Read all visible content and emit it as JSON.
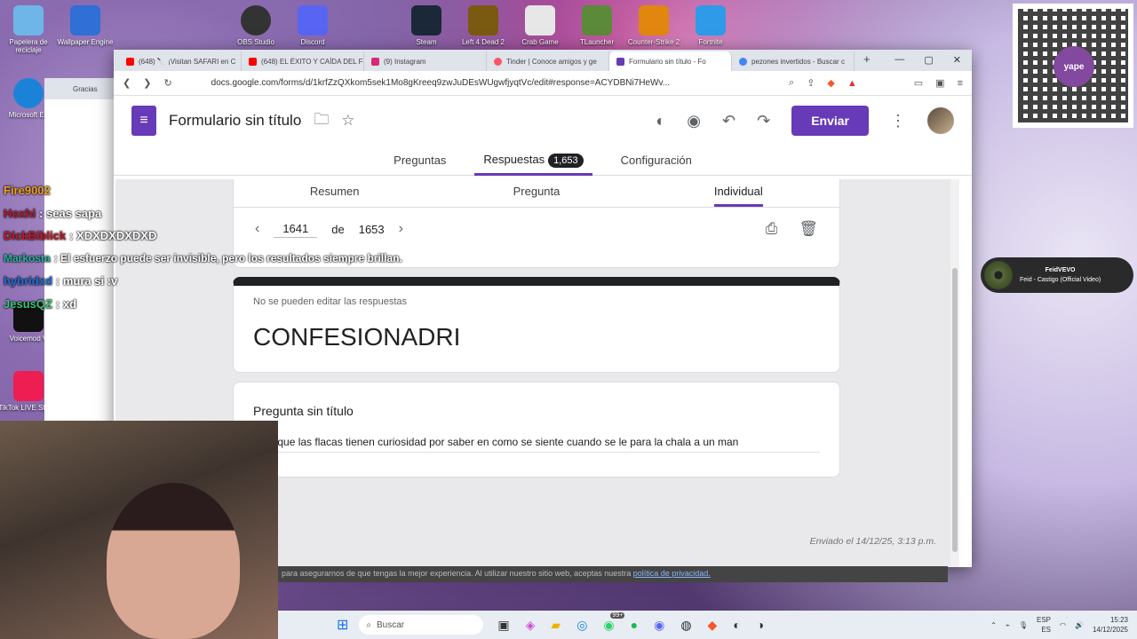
{
  "desktop_icons": [
    {
      "label": "Papelera de reciclaje",
      "color": "#6fb6e8"
    },
    {
      "label": "Wallpaper Engine",
      "color": "#2f6fd6"
    },
    {
      "label": "OBS Studio",
      "color": "#333333"
    },
    {
      "label": "Discord",
      "color": "#5865f2"
    },
    {
      "label": "Steam",
      "color": "#1b2838"
    },
    {
      "label": "Left 4 Dead 2",
      "color": "#7a5a10"
    },
    {
      "label": "Crab Game",
      "color": "#e7e7e7"
    },
    {
      "label": "TLauncher",
      "color": "#5b8a3a"
    },
    {
      "label": "Counter-Strike 2",
      "color": "#e1860f"
    },
    {
      "label": "Fortnite",
      "color": "#2f9ae8"
    },
    {
      "label": "Microsoft Ed",
      "color": "#1a83d8"
    },
    {
      "label": "Voicemod V",
      "color": "#111111"
    },
    {
      "label": "TikTok LIVE Studio",
      "color": "#ee1d52"
    }
  ],
  "browser": {
    "tabs": [
      {
        "label": "(648) 🔪 ¡Visitan SAFARI en C",
        "icon": "youtube-icon",
        "color": "#ff0000",
        "active": false
      },
      {
        "label": "(648) EL ÉXITO Y CAÍDA DEL F",
        "icon": "youtube-icon",
        "color": "#ff0000",
        "active": false
      },
      {
        "label": "(9) Instagram",
        "icon": "instagram-icon",
        "color": "#d62976",
        "active": false
      },
      {
        "label": "Tinder | Conoce amigos y ge",
        "icon": "tinder-icon",
        "color": "#fd5564",
        "active": false
      },
      {
        "label": "Formulario sin título - Fo",
        "icon": "forms-icon",
        "color": "#673ab7",
        "active": true
      },
      {
        "label": "pezones invertidos - Buscar c",
        "icon": "google-icon",
        "color": "#4285f4",
        "active": false
      }
    ],
    "url": "docs.google.com/forms/d/1krfZzQXkom5sek1Mo8gKreeq9zwJuDEsWUgwfjyqtVc/edit#response=ACYDBNi7HeWv..."
  },
  "forms": {
    "title": "Formulario sin título",
    "send_label": "Enviar",
    "tabs": {
      "questions": "Preguntas",
      "responses": "Respuestas",
      "responses_count": "1,653",
      "settings": "Configuración"
    },
    "sub_tabs": {
      "summary": "Resumen",
      "question": "Pregunta",
      "individual": "Individual"
    },
    "pager": {
      "current": "1641",
      "of": "de",
      "total": "1653"
    },
    "no_edit_note": "No se pueden editar las respuestas",
    "response_title": "CONFESIONADRI",
    "question_title": "Pregunta sin título",
    "answer": "rdad que las flacas tienen curiosidad por saber  en como se siente cuando se le para la chala a un man",
    "sent": "Enviado el 14/12/25, 3:13 p.m."
  },
  "chat": [
    {
      "user": "Fire9002",
      "message": "",
      "color": "#f0a020"
    },
    {
      "user": "Hoxhi",
      "message": ": seas sapa",
      "color": "#b01d2e"
    },
    {
      "user": "DickBiblick",
      "message": ": XDXDXDXDXD",
      "color": "#c41a2a"
    },
    {
      "user": "Markosta",
      "message": ": El esfuerzo puede ser invisible, pero los resultados siempre brillan.",
      "color": "#2bb3a0"
    },
    {
      "user": "hybridxd",
      "message": ": mura si :v",
      "color": "#1e6fd9"
    },
    {
      "user": "JesusQZ",
      "message": ": xd",
      "color": "#3cc47a"
    }
  ],
  "side_window": {
    "label": "Gracias"
  },
  "qr": {
    "brand": "yape"
  },
  "music": {
    "artist": "FeidVEVO",
    "song": "Feid - Castigo (Official Video)"
  },
  "cookie_banner": {
    "text": "para asegurarnos de que tengas la mejor experiencia. Al utilizar nuestro sitio web, aceptas nuestra ",
    "link": "política de privacidad."
  },
  "taskbar": {
    "search_placeholder": "Buscar",
    "lang": "ESP",
    "region": "ES",
    "time": "15:23",
    "date": "14/12/2025",
    "badge": "99+"
  }
}
